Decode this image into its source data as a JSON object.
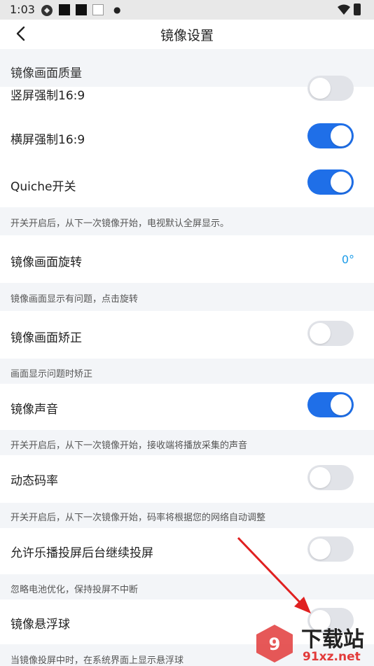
{
  "status": {
    "time": "1:03"
  },
  "header": {
    "title": "镜像设置"
  },
  "section": {
    "title": "镜像画面质量"
  },
  "rows": {
    "portrait": {
      "label": "竖屏强制16:9",
      "on": false
    },
    "landscape": {
      "label": "横屏强制16:9",
      "on": true
    },
    "quiche": {
      "label": "Quiche开关",
      "on": true
    },
    "rotate": {
      "label": "镜像画面旋转",
      "value": "0°"
    },
    "correct": {
      "label": "镜像画面矫正",
      "on": false
    },
    "sound": {
      "label": "镜像声音",
      "on": true
    },
    "bitrate": {
      "label": "动态码率",
      "on": false
    },
    "background": {
      "label": "允许乐播投屏后台继续投屏",
      "on": false
    },
    "floatball": {
      "label": "镜像悬浮球",
      "on": false
    }
  },
  "hints": {
    "quiche": "开关开启后，从下一次镜像开始，电视默认全屏显示。",
    "rotate": "镜像画面显示有问题，点击旋转",
    "correct": "画面显示问题时矫正",
    "sound": "开关开启后，从下一次镜像开始，接收端将播放采集的声音",
    "bitrate": "开关开启后，从下一次镜像开始，码率将根据您的网络自动调整",
    "background": "忽略电池优化，保持投屏不中断",
    "floatball": "当镜像投屏中时，在系统界面上显示悬浮球"
  },
  "watermark": {
    "brand": "下载站",
    "site": "91xz.net"
  },
  "colors": {
    "accent": "#1f6fe8",
    "value": "#1a9be8",
    "arrow": "#e02020"
  }
}
